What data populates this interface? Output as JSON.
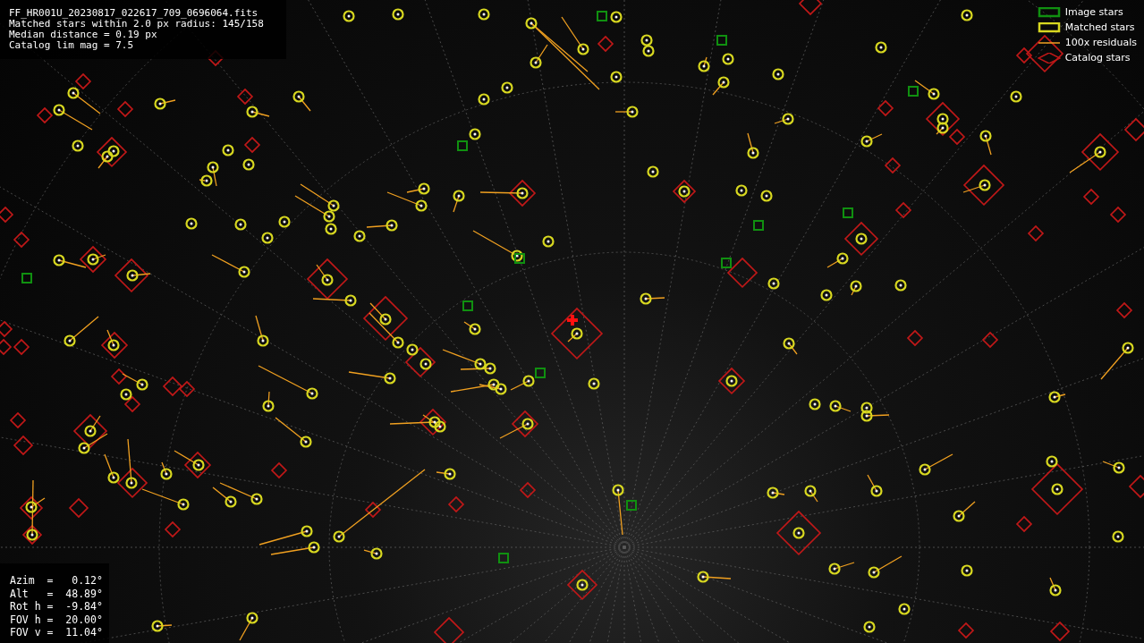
{
  "info_lines": [
    "FF_HR001U_20230817_022617_709_0696064.fits",
    "Matched stars within 2.0 px radius: 145/158",
    "Median distance = 0.19 px",
    "Catalog lim mag = 7.5"
  ],
  "legend": [
    {
      "kind": "image",
      "label": "Image stars"
    },
    {
      "kind": "matched",
      "label": "Matched stars"
    },
    {
      "kind": "residual",
      "label": "100x residuals"
    },
    {
      "kind": "catalog",
      "label": "Catalog stars"
    }
  ],
  "pointing": [
    "Azim  =   0.12°",
    "Alt   =  48.89°",
    "Rot h =  -9.84°",
    "FOV h =  20.00°",
    "FOV v =  11.04°"
  ]
}
